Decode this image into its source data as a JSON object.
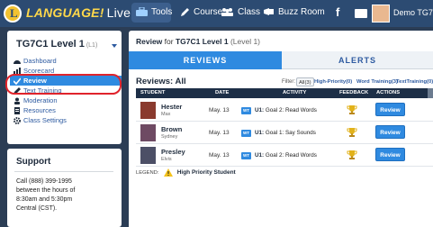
{
  "topbar": {
    "logo_letter": "L",
    "logo_text": "LANGUAGE!",
    "logo_live": "Live",
    "nav": [
      {
        "label": "Tools",
        "icon": "tools-icon"
      },
      {
        "label": "Course",
        "icon": "pencil-icon"
      },
      {
        "label": "Class",
        "icon": "people-icon"
      },
      {
        "label": "Buzz Room",
        "icon": "megaphone-icon"
      }
    ],
    "facebook_glyph": "f",
    "user_name": "Demo TG7C1"
  },
  "sidebar": {
    "class_name": "TG7C1 Level 1",
    "class_sub": "(L1)",
    "menu": [
      {
        "label": "Dashboard",
        "icon": "dashboard-icon",
        "active": false
      },
      {
        "label": "Scorecard",
        "icon": "scorecard-icon",
        "active": false
      },
      {
        "label": "Review",
        "icon": "check-icon",
        "active": true
      },
      {
        "label": "Text Training",
        "icon": "pencil-icon",
        "active": false
      },
      {
        "label": "Moderation",
        "icon": "moderation-icon",
        "active": false
      },
      {
        "label": "Resources",
        "icon": "resources-icon",
        "active": false
      },
      {
        "label": "Class Settings",
        "icon": "gear-icon",
        "active": false
      }
    ]
  },
  "support": {
    "title": "Support",
    "lines": [
      "Call (888) 399-1995",
      "between the hours of",
      "8:30am and 5:30pm",
      "Central (CST)."
    ]
  },
  "main": {
    "header_prefix": "Review",
    "header_for": "for",
    "header_class": "TG7C1 Level 1",
    "header_level": "(Level 1)",
    "tabs": [
      "REVIEWS",
      "ALERTS"
    ],
    "reviews_title": "Reviews: All",
    "filter_label": "Filter:",
    "filters": [
      "All(3)",
      "High-Priority(0)",
      "Word Training(3)",
      "TextTraining(0)"
    ],
    "columns": [
      "STUDENT",
      "DATE",
      "ACTIVITY",
      "FEEDBACK",
      "ACTIONS"
    ],
    "rows": [
      {
        "first": "Hester",
        "last": "Max",
        "date": "May. 13",
        "badge": "WT",
        "unit": "U1:",
        "activity": "Goal 2: Read Words",
        "action": "Review",
        "photo_color": "#8a3a2e"
      },
      {
        "first": "Brown",
        "last": "Sydney",
        "date": "May. 13",
        "badge": "WT",
        "unit": "U1:",
        "activity": "Goal 1: Say Sounds",
        "action": "Review",
        "photo_color": "#6e4a63"
      },
      {
        "first": "Presley",
        "last": "Elvis",
        "date": "May. 13",
        "badge": "WT",
        "unit": "U1:",
        "activity": "Goal 2: Read Words",
        "action": "Review",
        "photo_color": "#4c4f66"
      }
    ],
    "legend_label": "LEGEND:",
    "legend_text": "High Priority Student"
  },
  "colors": {
    "topbar": "#2c4b72",
    "accent": "#2f8ae0",
    "logo_yellow": "#ffd84a",
    "highlight_ring": "#e0232b"
  }
}
